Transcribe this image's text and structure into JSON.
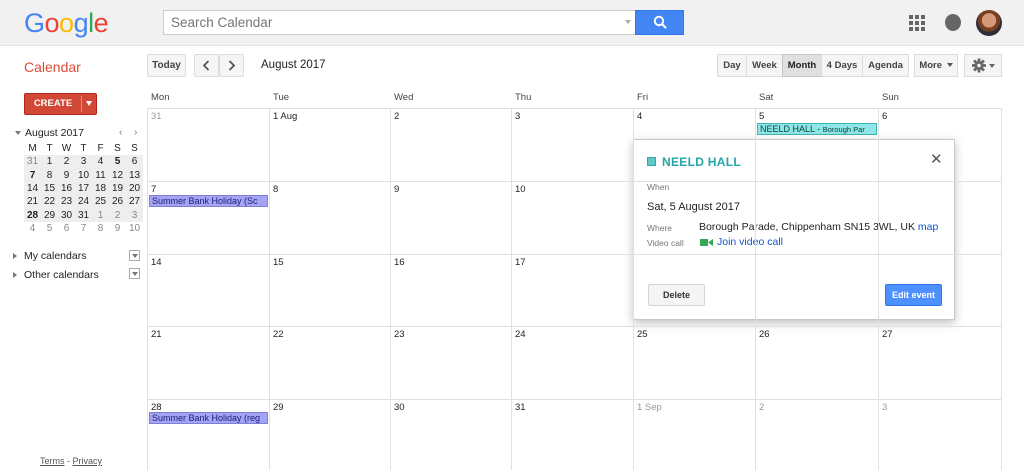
{
  "header": {
    "logo": [
      "G",
      "o",
      "o",
      "g",
      "l",
      "e"
    ],
    "logo_colors": [
      "#4285f4",
      "#ea4335",
      "#fbbc05",
      "#4285f4",
      "#34a853",
      "#ea4335"
    ],
    "search_placeholder": "Search Calendar",
    "search_icon": "search-icon",
    "apps_icon": "apps-grid-icon",
    "notifications_icon": "bell-icon"
  },
  "toolbar": {
    "app_title": "Calendar",
    "today": "Today",
    "current_period": "August 2017",
    "views": [
      "Day",
      "Week",
      "Month",
      "4 Days",
      "Agenda"
    ],
    "active_view": "Month",
    "more": "More"
  },
  "sidebar": {
    "create": "CREATE",
    "mini_calendar": {
      "title": "August 2017",
      "weekdays": [
        "M",
        "T",
        "W",
        "T",
        "F",
        "S",
        "S"
      ],
      "weeks": [
        [
          "31",
          "1",
          "2",
          "3",
          "4",
          "5",
          "6"
        ],
        [
          "7",
          "8",
          "9",
          "10",
          "11",
          "12",
          "13"
        ],
        [
          "14",
          "15",
          "16",
          "17",
          "18",
          "19",
          "20"
        ],
        [
          "21",
          "22",
          "23",
          "24",
          "25",
          "26",
          "27"
        ],
        [
          "28",
          "29",
          "30",
          "31",
          "1",
          "2",
          "3"
        ],
        [
          "4",
          "5",
          "6",
          "7",
          "8",
          "9",
          "10"
        ]
      ]
    },
    "my_calendars": "My calendars",
    "other_calendars": "Other calendars",
    "footer_terms": "Terms",
    "footer_sep": " - ",
    "footer_privacy": "Privacy"
  },
  "month_view": {
    "weekdays": [
      "Mon",
      "Tue",
      "Wed",
      "Thu",
      "Fri",
      "Sat",
      "Sun"
    ],
    "weeks": [
      [
        "31",
        "1 Aug",
        "2",
        "3",
        "4",
        "5",
        "6"
      ],
      [
        "7",
        "8",
        "9",
        "10",
        "11",
        "12",
        "13"
      ],
      [
        "14",
        "15",
        "16",
        "17",
        "18",
        "19",
        "20"
      ],
      [
        "21",
        "22",
        "23",
        "24",
        "25",
        "26",
        "27"
      ],
      [
        "28",
        "29",
        "30",
        "31",
        "1 Sep",
        "2",
        "3"
      ]
    ],
    "events": {
      "neeld_hall_title": "NEELD HALL",
      "neeld_hall_sep": " - ",
      "neeld_hall_location": "Borough Par",
      "bank_holiday_1": "Summer Bank Holiday (Sc",
      "bank_holiday_2": "Summer Bank Holiday (reg"
    },
    "event_colors": {
      "teal": "#8ee6e6",
      "holiday": "#a4a4f5"
    }
  },
  "popup": {
    "title": "NEELD HALL",
    "when_label": "When",
    "when": "Sat, 5 August 2017",
    "where_label": "Where",
    "where": "Borough Parade, Chippenham SN15 3WL, UK",
    "map_link": "map",
    "video_label": "Video call",
    "video_link": "Join video call",
    "delete": "Delete",
    "edit": "Edit event",
    "close_icon": "close-icon"
  }
}
